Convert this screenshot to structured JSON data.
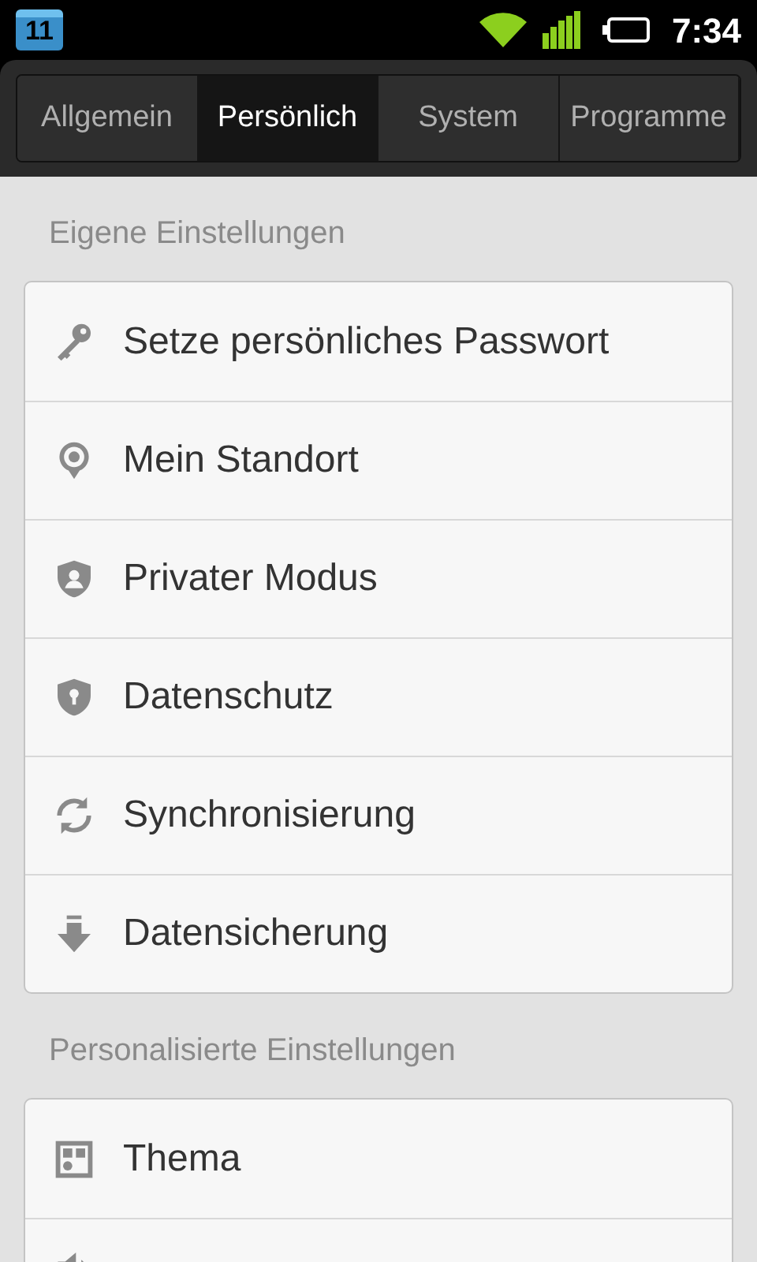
{
  "status_bar": {
    "notification": "11",
    "time": "7:34"
  },
  "tabs": [
    {
      "label": "Allgemein",
      "selected": false
    },
    {
      "label": "Persönlich",
      "selected": true
    },
    {
      "label": "System",
      "selected": false
    },
    {
      "label": "Programme",
      "selected": false
    }
  ],
  "sections": [
    {
      "title": "Eigene Einstellungen",
      "items": [
        {
          "label": "Setze persönliches Passwort"
        },
        {
          "label": "Mein Standort"
        },
        {
          "label": "Privater Modus"
        },
        {
          "label": "Datenschutz"
        },
        {
          "label": "Synchronisierung"
        },
        {
          "label": "Datensicherung"
        }
      ]
    },
    {
      "title": "Personalisierte Einstellungen",
      "items": [
        {
          "label": "Thema"
        }
      ]
    }
  ]
}
